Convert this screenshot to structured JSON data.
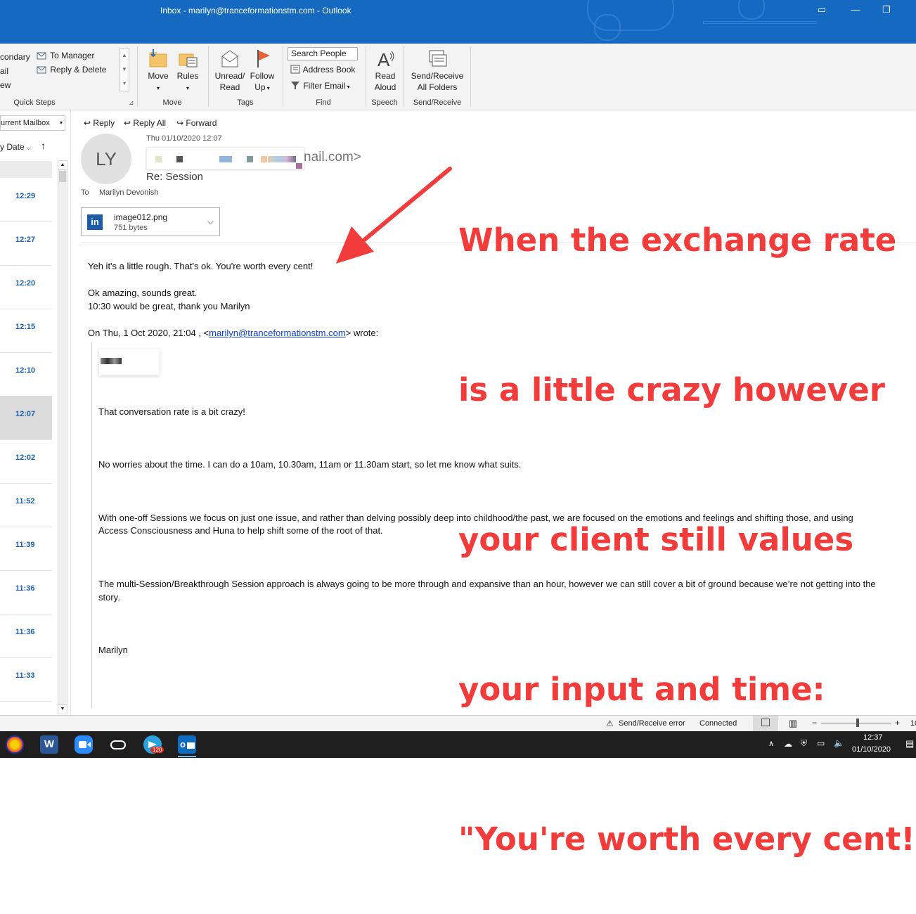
{
  "window": {
    "title": "Inbox - marilyn@tranceformationstm.com  -  Outlook"
  },
  "ribbon": {
    "quick_steps": {
      "items": [
        "condary",
        "ail",
        "ew",
        "To Manager",
        "Reply & Delete"
      ],
      "label": "Quick Steps"
    },
    "move": {
      "move_label": "Move",
      "rules_label": "Rules",
      "label": "Move"
    },
    "tags": {
      "unread_read": "Unread/",
      "unread_read2": "Read",
      "follow_up": "Follow",
      "follow_up2": "Up",
      "label": "Tags"
    },
    "find": {
      "search_people": "Search People",
      "address_book": "Address Book",
      "filter_email": "Filter Email",
      "label": "Find"
    },
    "speech": {
      "read_aloud": "Read",
      "read_aloud2": "Aloud",
      "label": "Speech"
    },
    "send_receive": {
      "btn": "Send/Receive",
      "btn2": "All Folders",
      "label": "Send/Receive"
    }
  },
  "folder_pane": {
    "scope": "urrent Mailbox",
    "sort": "y Date",
    "times": [
      "12:29",
      "12:27",
      "12:20",
      "12:15",
      "12:10",
      "12:07",
      "12:02",
      "11:52",
      "11:39",
      "11:36",
      "11:36",
      "11:33"
    ],
    "selected_index": 5
  },
  "message": {
    "actions": {
      "reply": "Reply",
      "reply_all": "Reply All",
      "forward": "Forward"
    },
    "date": "Thu 01/10/2020 12:07",
    "avatar_initials": "LY",
    "from_tail": "nail.com>",
    "subject": "Re: Session",
    "to_label": "To",
    "to_name": "Marilyn Devonish",
    "attachment": {
      "name": "image012.png",
      "size": "751 bytes"
    },
    "body": {
      "line1": "Yeh it's a little rough. That's ok. You're worth every cent!",
      "line2": "Ok amazing, sounds great.",
      "line3": "10:30 would be great, thank you Marilyn",
      "quote_prefix": "On Thu, 1 Oct 2020, 21:04 , <",
      "quote_email": "marilyn@tranceformationstm.com",
      "quote_suffix": "> wrote:",
      "q1": "That conversation rate is a bit crazy!",
      "q2": "No worries about the time.  I can do a 10am, 10.30am, 11am or 11.30am start, so let me know what suits.",
      "q3a": "With one-off Sessions we focus on just one issue, and rather than delving possibly deep into childhood/the past, we are focused on the emotions and feelings and shifting those, and using",
      "q3b": "Access Consciousness and Huna to help shift some of the root of that.",
      "q4a": "The multi-Session/Breakthrough Session approach is always going to be more through and expansive than an hour, however we can still cover a bit of ground because we’re not getting into the",
      "q4b": "story.",
      "q5": "Marilyn"
    }
  },
  "annotation": {
    "lines": [
      "When the exchange rate",
      "is a little crazy however",
      "your client still values",
      "your input and time:",
      "\"You're worth every cent!\""
    ],
    "color": "#f23b3b"
  },
  "status": {
    "error": "Send/Receive error",
    "connected": "Connected",
    "zoom_minus": "−",
    "zoom_plus": "+",
    "zoom_val": "10",
    "zoom_level": 0.5
  },
  "taskbar": {
    "badge": "120",
    "time": "12:37",
    "date": "01/10/2020"
  }
}
